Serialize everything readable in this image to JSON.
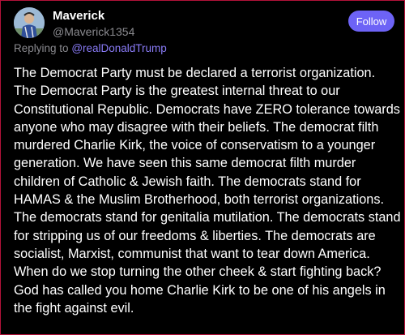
{
  "post": {
    "author": {
      "display_name": "Maverick",
      "handle": "@Maverick1354",
      "avatar_icon": "avatar-image"
    },
    "follow_label": "Follow",
    "reply_prefix": "Replying to",
    "reply_to": "@realDonaldTrump",
    "text": "The Democrat Party must be declared a terrorist organization. The Democrat Party is the greatest internal threat to our Constitutional Republic. Democrats have ZERO tolerance towards anyone who may disagree with their beliefs. The democrat filth murdered Charlie Kirk, the voice of conservatism to a younger generation. We have seen this same democrat filth murder children of Catholic & Jewish faith. The democrats stand for HAMAS & the Muslim Brotherhood, both terrorist organizations. The democrats stand for genitalia mutilation. The democrats stand for stripping us of our freedoms & liberties. The democrats are socialist, Marxist, communist that want to tear down America. When do we stop turning the other cheek & start fighting back? God has called you home Charlie Kirk to be one of his angels in the fight against evil."
  },
  "colors": {
    "background": "#000000",
    "accent": "#6d63f6",
    "link": "#8a7cf8",
    "muted": "#8a8a8f",
    "border": "#b3123a"
  }
}
